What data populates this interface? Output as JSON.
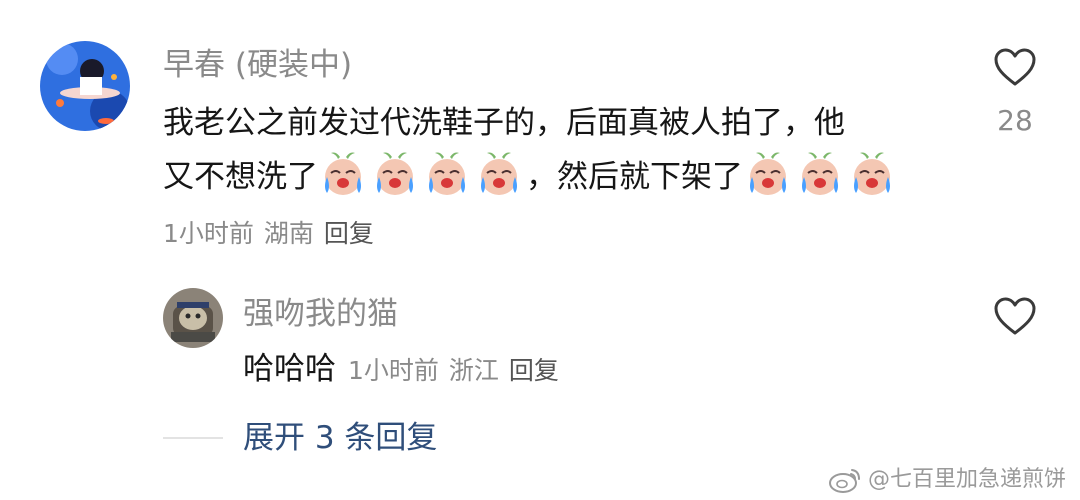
{
  "comment": {
    "username": "早春 (硬装中)",
    "text_line1": "我老公之前发过代洗鞋子的，后面真被人拍了，他",
    "text_line2_a": "又不想洗了",
    "text_line2_b": "，然后就下架了",
    "emoji_name": "crying-face-emoji",
    "time": "1小时前",
    "location": "湖南",
    "reply_label": "回复",
    "like_count": "28"
  },
  "reply": {
    "username": "强吻我的猫",
    "text": "哈哈哈",
    "time": "1小时前",
    "location": "浙江",
    "reply_label": "回复"
  },
  "expand_label": "展开 3 条回复",
  "watermark": "@七百里加急递煎饼",
  "colors": {
    "meta_text": "#8a8a8a",
    "link_blue": "#2f4e7a",
    "main_text": "#161616"
  }
}
